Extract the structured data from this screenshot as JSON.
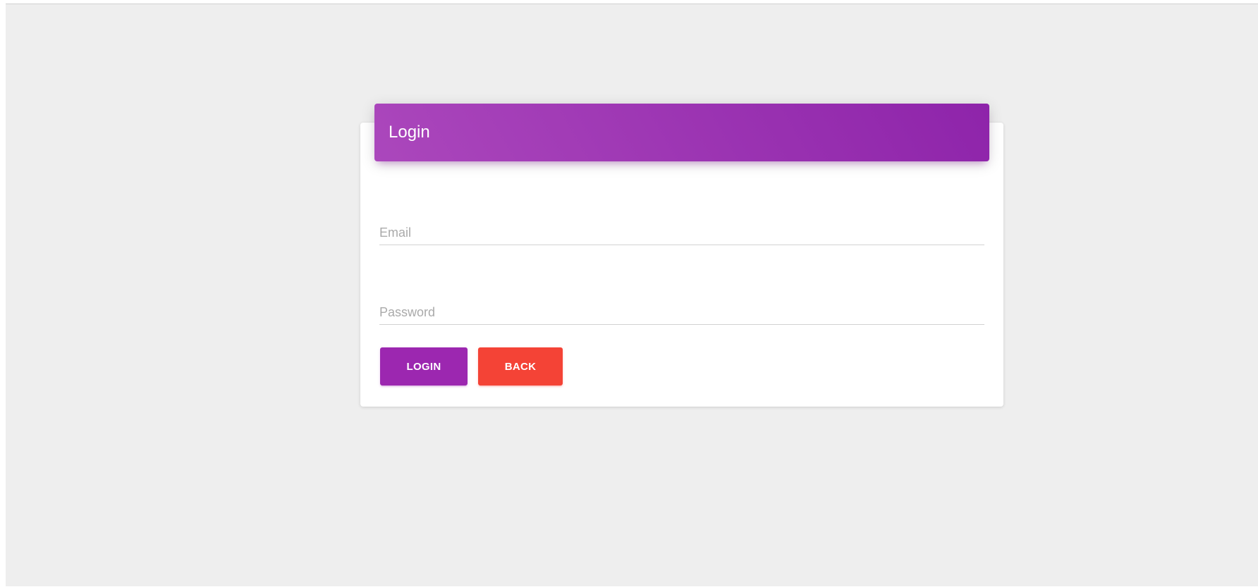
{
  "card": {
    "title": "Login"
  },
  "form": {
    "email": {
      "placeholder": "Email",
      "value": ""
    },
    "password": {
      "placeholder": "Password",
      "value": ""
    },
    "login_label": "LOGIN",
    "back_label": "BACK"
  },
  "colors": {
    "background": "#eeeeee",
    "header_gradient_start": "#ab47bc",
    "header_gradient_end": "#8e24aa",
    "login_button": "#9c27b0",
    "back_button": "#f44336"
  }
}
